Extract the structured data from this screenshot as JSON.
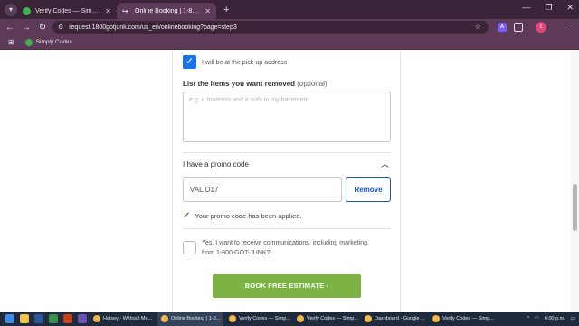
{
  "browser": {
    "tabs": [
      {
        "title": "Verify Codes — SimplyCodes",
        "active": false,
        "icon": "simplycodes-icon"
      },
      {
        "title": "Online Booking | 1-800-GOT-JUNK?",
        "active": true,
        "icon": "junk-icon"
      }
    ],
    "new_tab": "+",
    "url": "request.1800gotjunk.com/us_en/onlinebooking?page=step3",
    "extension_letter": "A",
    "profile_initial": "c",
    "bookmarks": [
      {
        "label": "Simply Codes"
      }
    ]
  },
  "form": {
    "pickup_checkbox_label": "I will be at the pick-up address",
    "items_label": "List the items you want removed",
    "items_optional": "(optional)",
    "items_placeholder": "e.g. a mattress and a sofa in my basement",
    "promo_header": "I have a promo code",
    "promo_value": "VALID17",
    "remove_label": "Remove",
    "applied_message": "Your promo code has been applied.",
    "marketing_label": "Yes, I want to receive communications, including marketing, from 1-800-GOT-JUNK?",
    "book_button": "BOOK FREE ESTIMATE"
  },
  "taskbar": {
    "apps": [
      {
        "label": "Halsey - Without Me...",
        "color": "#f2b84b",
        "active": false
      },
      {
        "label": "Online Booking | 1-8...",
        "color": "#f2b84b",
        "active": true
      },
      {
        "label": "Verify Codes — Simp...",
        "color": "#f2b84b",
        "active": false
      },
      {
        "label": "Verify Codes — Simp...",
        "color": "#f2b84b",
        "active": false
      },
      {
        "label": "Dashboard - Google ...",
        "color": "#f2b84b",
        "active": false
      },
      {
        "label": "Verify Codes — Simp...",
        "color": "#f2b84b",
        "active": false
      }
    ],
    "time": "6:00 p.m."
  },
  "colors": {
    "accent_blue": "#1a73e8",
    "book_green": "#7cb342",
    "remove_blue": "#1a56c4",
    "applied_green": "#4c8a2a"
  }
}
